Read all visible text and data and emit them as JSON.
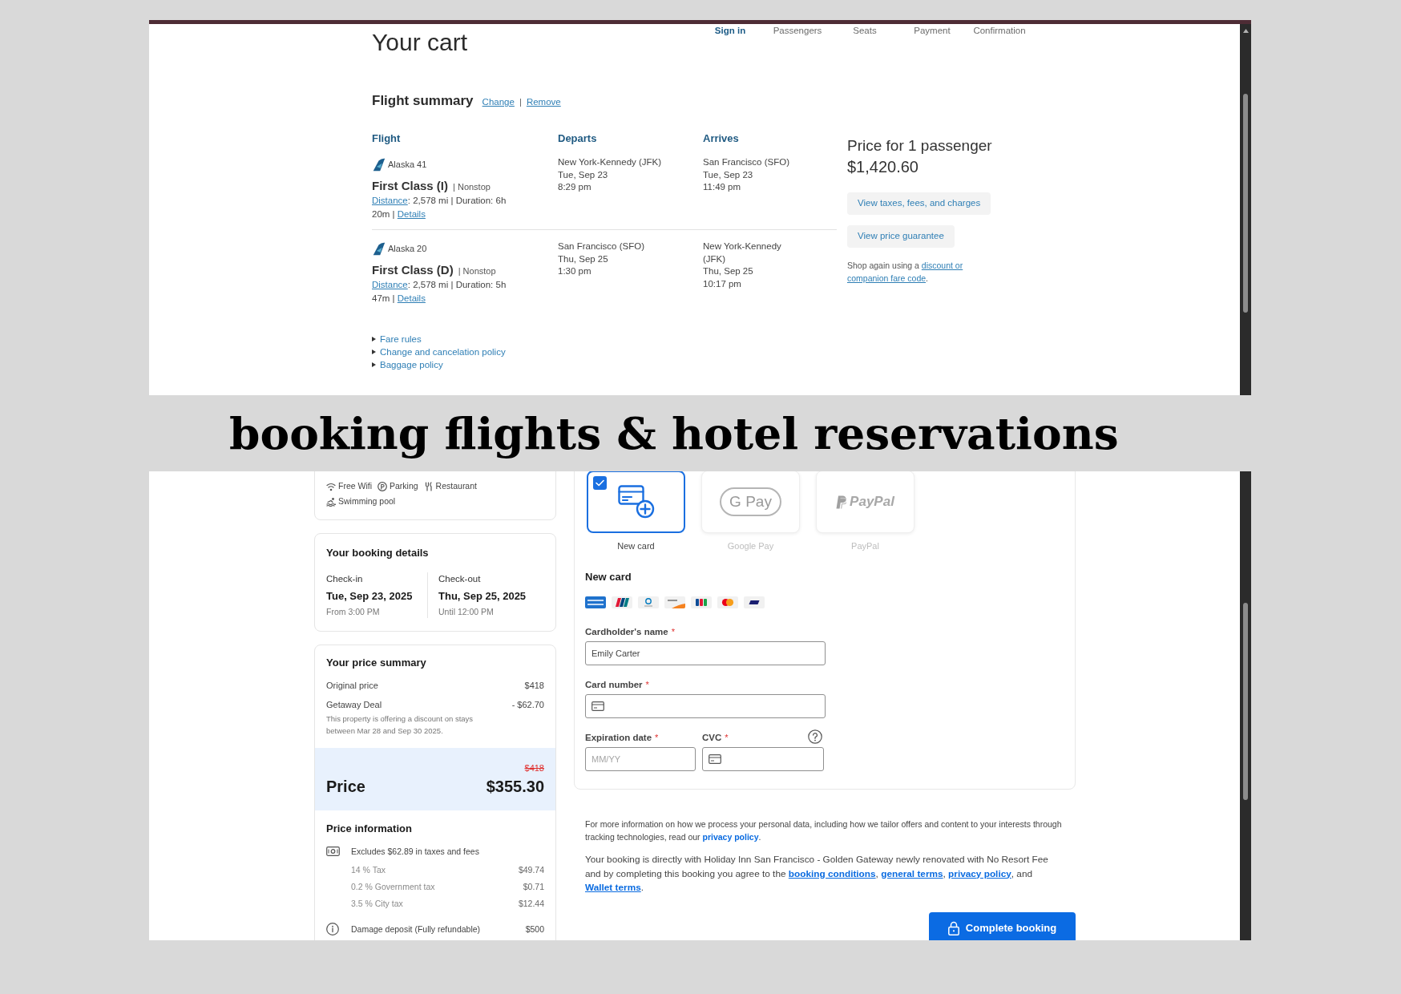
{
  "flight_cart": {
    "title": "Your cart",
    "steps": [
      {
        "label": "Sign in",
        "selected": true
      },
      {
        "label": "Passengers",
        "selected": false
      },
      {
        "label": "Seats",
        "selected": false
      },
      {
        "label": "Payment",
        "selected": false
      },
      {
        "label": "Confirmation",
        "selected": false
      }
    ],
    "flight_summary": {
      "title": "Flight summary",
      "actions": [
        {
          "kind": "link",
          "text": "Change"
        },
        {
          "kind": "separator",
          "text": "|"
        },
        {
          "kind": "link",
          "text": "Remove"
        }
      ]
    },
    "table": {
      "columns": [
        "Flight",
        "Departs",
        "Arrives"
      ],
      "rows": [
        {
          "airline": "Alaska 41",
          "cabin": "First Class (I)",
          "stops": "| Nonstop",
          "info": [
            {
              "kind": "link",
              "text": "Distance"
            },
            {
              "kind": "text",
              "text": ": 2,578 mi | Duration: 6h 20m | "
            },
            {
              "kind": "link",
              "text": "Details"
            }
          ],
          "departs": [
            "New York-Kennedy (JFK)",
            "Tue, Sep 23",
            "8:29 pm"
          ],
          "arrives": [
            "San Francisco (SFO)",
            "Tue, Sep 23",
            "11:49 pm"
          ]
        },
        {
          "airline": "Alaska 20",
          "cabin": "First Class (D)",
          "stops": "| Nonstop",
          "info": [
            {
              "kind": "link",
              "text": "Distance"
            },
            {
              "kind": "text",
              "text": ": 2,578 mi | Duration: 5h 47m | "
            },
            {
              "kind": "link",
              "text": "Details"
            }
          ],
          "departs": [
            "San Francisco (SFO)",
            "Thu, Sep 25",
            "1:30 pm"
          ],
          "arrives": [
            "New York-Kennedy (JFK)",
            "Thu, Sep 25",
            "10:17 pm"
          ]
        }
      ]
    },
    "policy_links": [
      "Fare rules",
      "Change and cancelation policy",
      "Baggage policy"
    ],
    "price": {
      "heading": "Price for 1 passenger",
      "total": "$1,420.60",
      "buttons": [
        "View taxes, fees, and charges",
        "View price guarantee"
      ],
      "note": [
        {
          "kind": "text",
          "text": "Shop again using a "
        },
        {
          "kind": "link",
          "text": "discount or "
        },
        {
          "kind": "link",
          "text": "companion fare code"
        },
        {
          "kind": "text",
          "text": "."
        }
      ]
    }
  },
  "caption": "booking flights & hotel reservations",
  "hotel_booking": {
    "amenities": [
      {
        "kind": "wifi",
        "label": "Free Wifi"
      },
      {
        "kind": "parking",
        "label": "Parking"
      },
      {
        "kind": "restaurant",
        "label": "Restaurant"
      },
      {
        "kind": "pool",
        "label": "Swimming pool"
      }
    ],
    "booking_details": {
      "title": "Your booking details",
      "columns": [
        {
          "label": "Check-in",
          "date": "Tue, Sep 23, 2025",
          "time": "From 3:00 PM"
        },
        {
          "label": "Check-out",
          "date": "Thu, Sep 25, 2025",
          "time": "Until 12:00 PM"
        }
      ]
    },
    "price_summary": {
      "title": "Your price summary",
      "lines": [
        {
          "label": "Original price",
          "value": "$418"
        },
        {
          "label": "Getaway Deal",
          "value": "- $62.70",
          "note": "This property is offering a discount on stays between Mar 28 and Sep 30 2025."
        }
      ],
      "old_price": "$418",
      "price_label": "Price",
      "price": "$355.30"
    },
    "price_information": {
      "title": "Price information",
      "excludes": "Excludes $62.89 in taxes and fees",
      "taxes": [
        {
          "label": "14 % Tax",
          "value": "$49.74"
        },
        {
          "label": "0.2 % Government tax",
          "value": "$0.71"
        },
        {
          "label": "3.5 % City tax",
          "value": "$12.44"
        }
      ],
      "deposit": {
        "label": "Damage deposit (Fully refundable)",
        "value": "$500"
      }
    },
    "payment": {
      "methods": [
        {
          "kind": "card",
          "label": "New card",
          "selected": true
        },
        {
          "kind": "gpay",
          "label": "Google Pay",
          "logo_text": "G Pay",
          "selected": false
        },
        {
          "kind": "paypal",
          "label": "PayPal",
          "logo_text": "PayPal",
          "selected": false
        }
      ],
      "form_title": "New card",
      "field_rows": [
        [
          {
            "kind": "text",
            "label": "Cardholder's name",
            "required_mark": "*",
            "value": "Emily Carter"
          }
        ],
        [
          {
            "kind": "card",
            "label": "Card number",
            "required_mark": "*"
          }
        ],
        [
          {
            "kind": "text",
            "label": "Expiration date",
            "required_mark": "*",
            "placeholder": "MM/YY"
          },
          {
            "kind": "card",
            "label": "CVC",
            "required_mark": "*",
            "help": true
          }
        ]
      ]
    },
    "privacy_note": [
      {
        "kind": "text",
        "text": "For more information on how we process your personal data, including how we tailor offers and content to your interests through tracking technologies, read our "
      },
      {
        "kind": "link",
        "text": "privacy policy"
      },
      {
        "kind": "text",
        "text": "."
      }
    ],
    "terms": [
      {
        "kind": "text",
        "text": "Your booking is directly with Holiday Inn San Francisco - Golden Gateway newly renovated with No Resort Fee and by completing this booking you agree to the "
      },
      {
        "kind": "link",
        "text": "booking conditions"
      },
      {
        "kind": "text",
        "text": ", "
      },
      {
        "kind": "link",
        "text": "general terms"
      },
      {
        "kind": "text",
        "text": ", "
      },
      {
        "kind": "link",
        "text": "privacy policy"
      },
      {
        "kind": "text",
        "text": ", and "
      },
      {
        "kind": "link",
        "text": "Wallet terms"
      },
      {
        "kind": "text",
        "text": "."
      }
    ],
    "submit_button": "Complete booking"
  }
}
